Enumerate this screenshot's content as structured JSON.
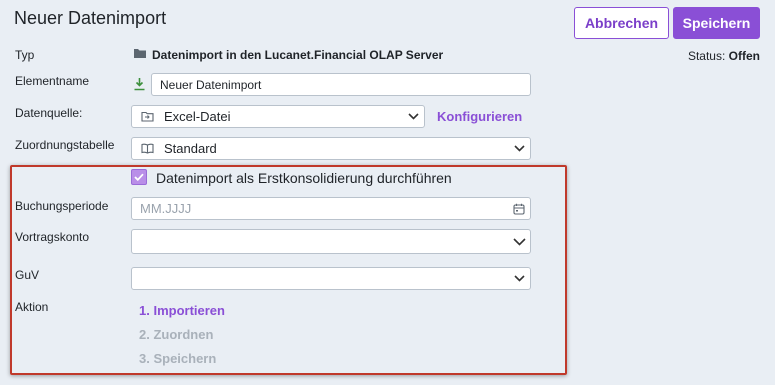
{
  "header": {
    "title": "Neuer Datenimport",
    "cancel_label": "Abbrechen",
    "save_label": "Speichern"
  },
  "status": {
    "label": "Status:",
    "value": "Offen"
  },
  "form": {
    "typ": {
      "label": "Typ",
      "value": "Datenimport in den Lucanet.Financial OLAP Server"
    },
    "elementname": {
      "label": "Elementname",
      "value": "Neuer Datenimport"
    },
    "datenquelle": {
      "label": "Datenquelle:",
      "value": "Excel-Datei",
      "configure_label": "Konfigurieren"
    },
    "zuordnungstabelle": {
      "label": "Zuordnungstabelle",
      "value": "Standard"
    },
    "erstkonsolidierung": {
      "label": "Datenimport als Erstkonsolidierung durchführen",
      "checked": true
    },
    "buchungsperiode": {
      "label": "Buchungsperiode",
      "placeholder": "MM.JJJJ"
    },
    "vortragskonto": {
      "label": "Vortragskonto",
      "value": ""
    },
    "guv": {
      "label": "GuV",
      "value": ""
    },
    "aktion": {
      "label": "Aktion",
      "steps": [
        {
          "label": "1. Importieren",
          "active": true
        },
        {
          "label": "2. Zuordnen",
          "active": false
        },
        {
          "label": "3. Speichern",
          "active": false
        }
      ]
    }
  },
  "colors": {
    "accent": "#8a4fd6",
    "highlight_border": "#c0392b",
    "inactive_step": "#a9b1ba",
    "background": "#e9eef4"
  }
}
